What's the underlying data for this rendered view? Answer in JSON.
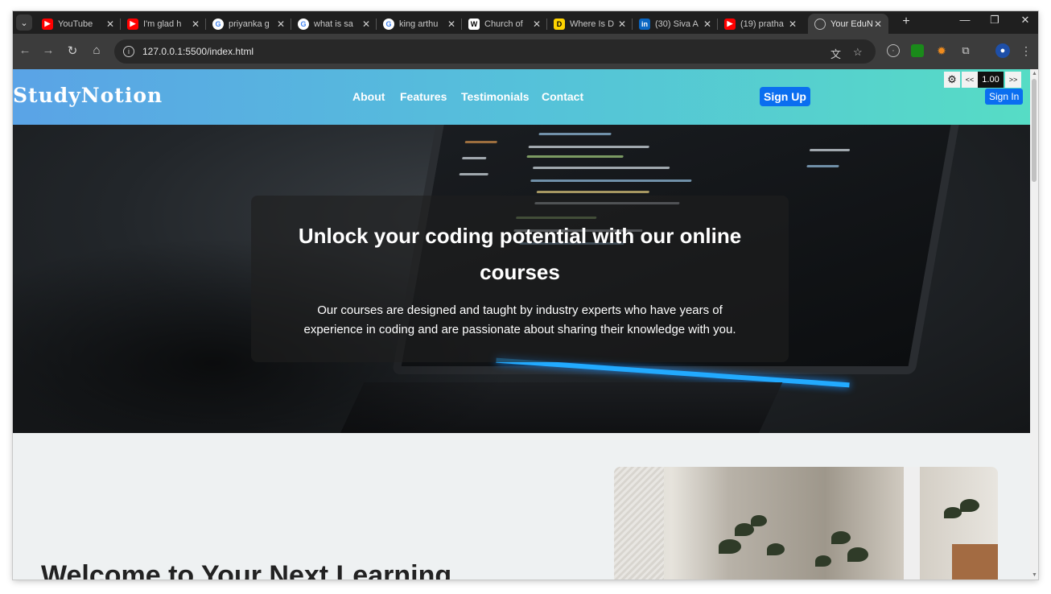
{
  "browser": {
    "tabs": [
      {
        "title": "YouTube",
        "favicon": "youtube-icon",
        "active": false
      },
      {
        "title": "I'm glad h",
        "favicon": "youtube-icon",
        "active": false
      },
      {
        "title": "priyanka g",
        "favicon": "google-icon",
        "active": false
      },
      {
        "title": "what is sa",
        "favicon": "google-icon",
        "active": false
      },
      {
        "title": "king arthu",
        "favicon": "google-icon",
        "active": false
      },
      {
        "title": "Church of",
        "favicon": "wikipedia-icon",
        "active": false
      },
      {
        "title": "Where Is D",
        "favicon": "d-icon",
        "active": false
      },
      {
        "title": "(30) Siva A",
        "favicon": "linkedin-icon",
        "active": false
      },
      {
        "title": "(19) pratha",
        "favicon": "youtube-icon",
        "active": false
      },
      {
        "title": "Your EduN",
        "favicon": "globe-icon",
        "active": true
      }
    ],
    "address": "127.0.0.1:5500/index.html"
  },
  "site": {
    "logo": "StudyNotion",
    "nav": [
      "About",
      "Features",
      "Testimonials",
      "Contact"
    ],
    "signup": "Sign Up",
    "signin": "Sign In",
    "speed_value": "1.00",
    "speed_prev": "<<",
    "speed_next": ">>"
  },
  "hero": {
    "title": "Unlock your coding potential with our online courses",
    "subtitle": "Our courses are designed and taught by industry experts who have years of experience in coding and are passionate about sharing their knowledge with you."
  },
  "welcome": {
    "title": "Welcome to Your Next Learning"
  },
  "colors": {
    "nav_gradient_start": "#5aa3e6",
    "nav_gradient_end": "#56dcc5",
    "button_blue": "#0a6ef0"
  }
}
